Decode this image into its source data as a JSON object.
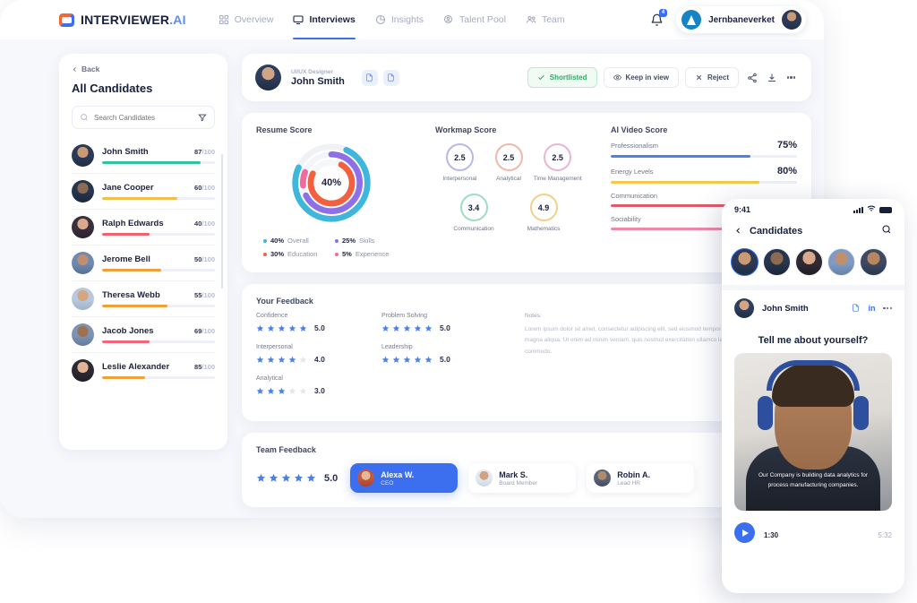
{
  "header": {
    "brand_name": "INTERVIEWER",
    "brand_suffix": ".AI",
    "nav": [
      {
        "label": "Overview",
        "icon": "grid-icon",
        "active": false
      },
      {
        "label": "Interviews",
        "icon": "monitor-icon",
        "active": true
      },
      {
        "label": "Insights",
        "icon": "pie-chart-icon",
        "active": false
      },
      {
        "label": "Talent Pool",
        "icon": "user-search-icon",
        "active": false
      },
      {
        "label": "Team",
        "icon": "users-icon",
        "active": false
      }
    ],
    "notification_count": "4",
    "org_name": "Jernbaneverket"
  },
  "sidebar": {
    "back_label": "Back",
    "title": "All Candidates",
    "search_placeholder": "Search Candidates",
    "candidates": [
      {
        "name": "John Smith",
        "score": "87",
        "denominator": "/100",
        "bar_pct": 87,
        "color": "#2fc49b"
      },
      {
        "name": "Jane Cooper",
        "score": "60",
        "denominator": "/100",
        "bar_pct": 67,
        "color": "#f0c04a"
      },
      {
        "name": "Ralph Edwards",
        "score": "40",
        "denominator": "/100",
        "bar_pct": 42,
        "color": "#f2616f"
      },
      {
        "name": "Jerome Bell",
        "score": "50",
        "denominator": "/100",
        "bar_pct": 52,
        "color": "#eda13a"
      },
      {
        "name": "Theresa Webb",
        "score": "55",
        "denominator": "/100",
        "bar_pct": 58,
        "color": "#eda13a"
      },
      {
        "name": "Jacob Jones",
        "score": "69",
        "denominator": "/100",
        "bar_pct": 42,
        "color": "#f4647a"
      },
      {
        "name": "Leslie Alexander",
        "score": "85",
        "denominator": "/100",
        "bar_pct": 38,
        "color": "#e9a košice"
      }
    ]
  },
  "profile": {
    "role": "UI/UX Designer",
    "name": "John Smith",
    "doc_icons": [
      "resume-file-icon",
      "cover-letter-file-icon"
    ],
    "actions": [
      {
        "label": "Shortlisted",
        "icon": "check-icon",
        "style": "shortlisted"
      },
      {
        "label": "Keep in view",
        "icon": "eye-icon",
        "style": "plain"
      },
      {
        "label": "Reject",
        "icon": "close-icon",
        "style": "plain"
      }
    ],
    "icon_actions": [
      "share-icon",
      "download-icon",
      "more-icon"
    ]
  },
  "resume_score": {
    "title": "Resume Score",
    "center_label": "40%",
    "legend": [
      {
        "value": "40%",
        "key": "Overall",
        "color": "#3fb6dc"
      },
      {
        "value": "25%",
        "key": "Skills",
        "color": "#8d6fe8"
      },
      {
        "value": "30%",
        "key": "Education",
        "color": "#f2613f"
      },
      {
        "value": "5%",
        "key": "Experience",
        "color": "#f06ba0"
      }
    ]
  },
  "workmap_score": {
    "title": "Workmap Score",
    "row1": [
      {
        "value": "2.5",
        "label": "Interpersonal",
        "color": "#b7b9e8"
      },
      {
        "value": "2.5",
        "label": "Analytical",
        "color": "#f0b9ab"
      },
      {
        "value": "2.5",
        "label": "Time Management",
        "color": "#e9b6d2"
      }
    ],
    "row2": [
      {
        "value": "3.4",
        "label": "Communication",
        "color": "#9fdcc6"
      },
      {
        "value": "4.9",
        "label": "Mathematics",
        "color": "#f2d08a"
      }
    ]
  },
  "ai_video_score": {
    "title": "AI Video Score",
    "items": [
      {
        "label": "Professionalism",
        "pct": "75%",
        "value": 75,
        "color": "#4c82e8"
      },
      {
        "label": "Energy Levels",
        "pct": "80%",
        "value": 80,
        "color": "#f2c94c"
      },
      {
        "label": "Communication",
        "pct": "",
        "value": 72,
        "color": "#e05a6b"
      },
      {
        "label": "Sociability",
        "pct": "",
        "value": 66,
        "color": "#ef8aa6"
      }
    ]
  },
  "your_feedback": {
    "title": "Your Feedback",
    "column1": [
      {
        "label": "Confidence",
        "stars": 5,
        "value": "5.0"
      },
      {
        "label": "Interpersonal",
        "stars": 4,
        "value": "4.0"
      },
      {
        "label": "Analytical",
        "stars": 3,
        "value": "3.0"
      }
    ],
    "column2": [
      {
        "label": "Problem Solving",
        "stars": 5,
        "value": "5.0"
      },
      {
        "label": "Leadership",
        "stars": 5,
        "value": "5.0"
      }
    ],
    "notes_label": "Notes:",
    "notes_text": "Lorem ipsum dolor sit amet, consectetur adipiscing elit, sed eiusmod tempor incididunt ut labore et dolore magna aliqua. Ut enim ad minim veniam, quis nostrud exercitation ullamco laboris nisi ut aliquip ex ea commodo."
  },
  "team_feedback": {
    "title": "Team Feedback",
    "stars": 5,
    "value": "5.0",
    "members": [
      {
        "name": "Alexa W.",
        "role": "CEO",
        "active": true
      },
      {
        "name": "Mark S.",
        "role": "Board Member",
        "active": false
      },
      {
        "name": "Robin A.",
        "role": "Lead HR",
        "active": false
      }
    ]
  },
  "phone": {
    "status_time": "9:41",
    "header_title": "Candidates",
    "back_icon": "chevron-left-icon",
    "search_icon": "search-icon",
    "avatar_count": 5,
    "selected_avatar_index": 0,
    "person_name": "John Smith",
    "person_icons": [
      "resume-file-icon",
      "linkedin-icon",
      "more-icon"
    ],
    "linkedin_label": "in",
    "question": "Tell me about yourself?",
    "caption": "Our Company is building data analytics for process manufacturing companies.",
    "current_time": "1:30",
    "total_time": "5:32",
    "progress_pct": 27
  }
}
